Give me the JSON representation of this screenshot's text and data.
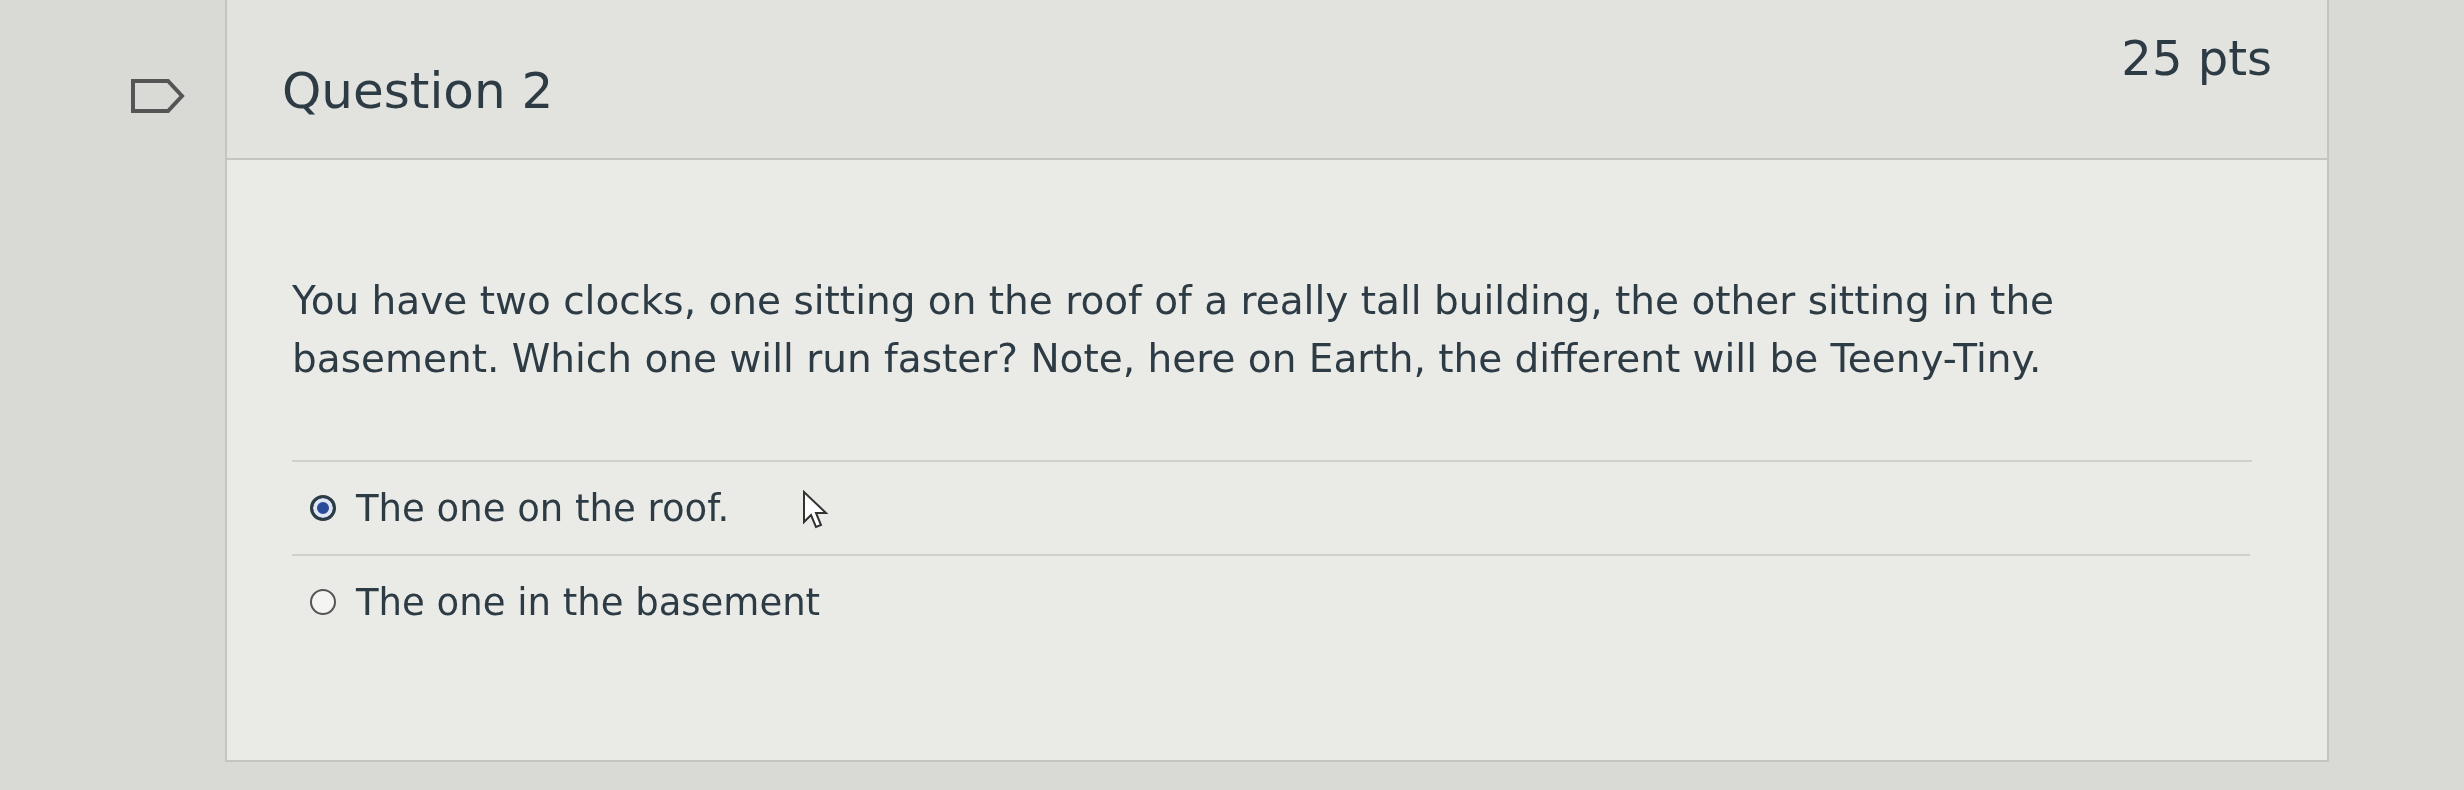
{
  "question": {
    "title": "Question 2",
    "points": "25 pts",
    "text": "You have two clocks, one sitting on the roof of a really tall building, the other sitting in the basement.  Which one will run faster? Note, here on Earth, the different will be Teeny-Tiny.",
    "answers": [
      {
        "label": "The one on the roof.",
        "selected": true
      },
      {
        "label": "The one in the basement",
        "selected": false
      }
    ]
  }
}
